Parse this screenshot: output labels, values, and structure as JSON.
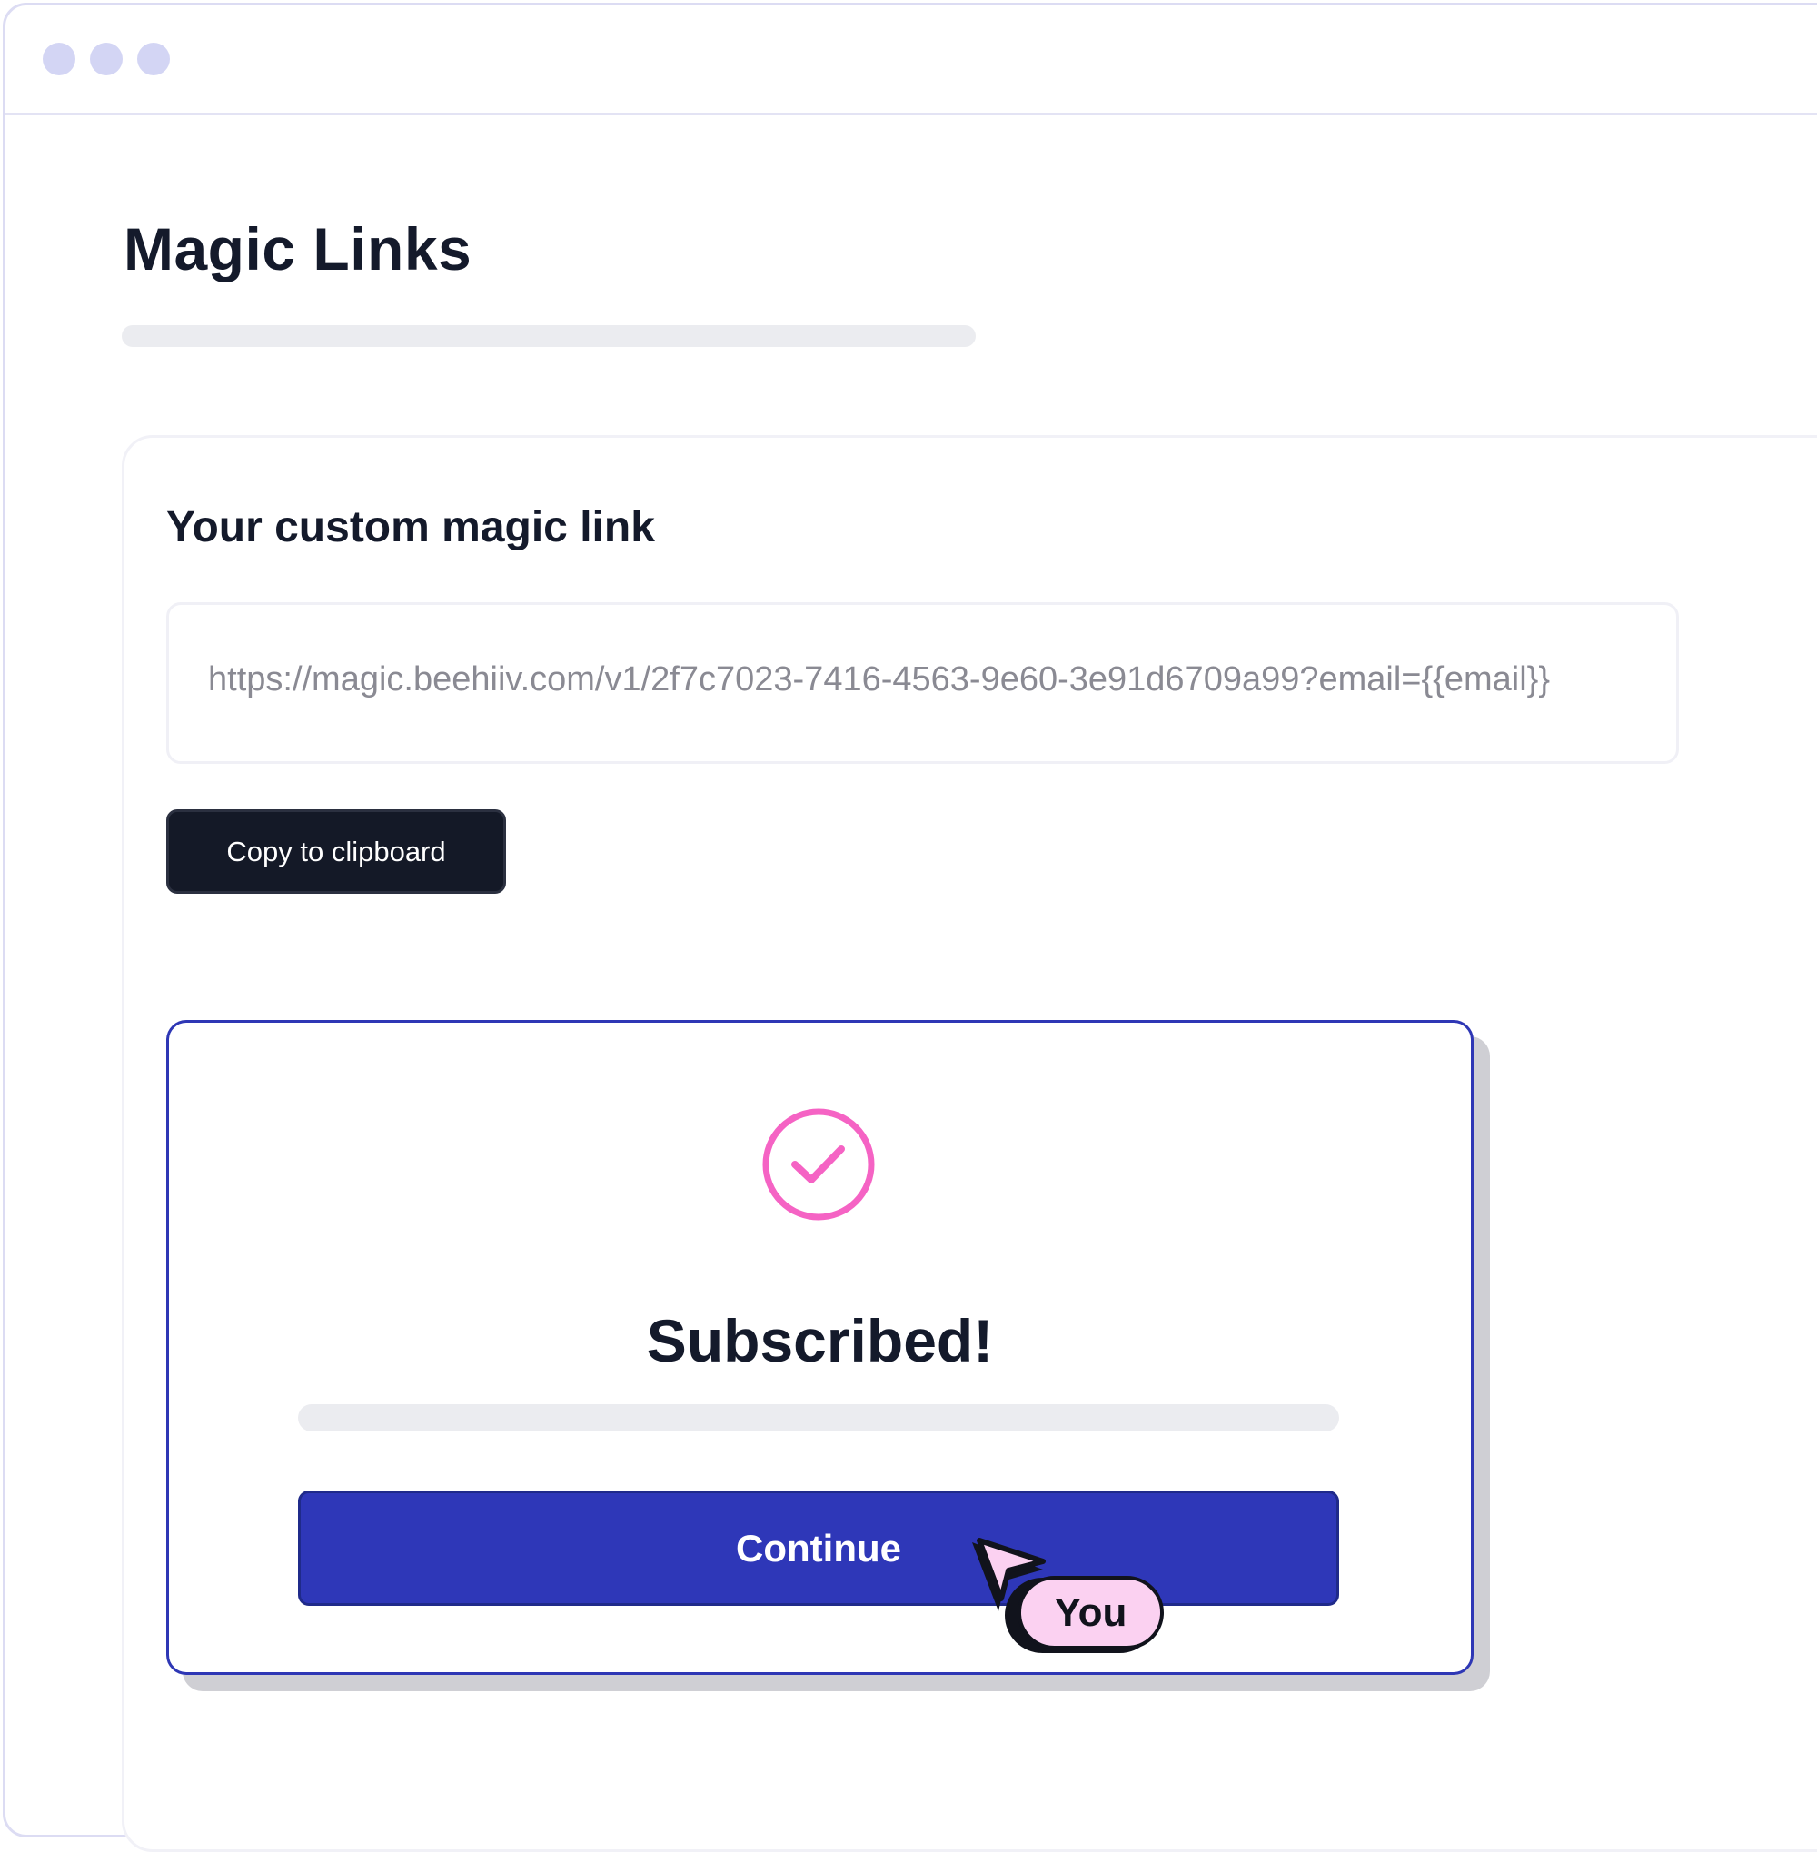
{
  "colors": {
    "window_dots": "#d3d5f4",
    "placeholder_bar": "#ebecf0",
    "dark_button": "#141927",
    "modal_border": "#2e37b5",
    "primary_button": "#2e37b8",
    "check_accent": "#f563c4",
    "you_badge": "#fbd1f1"
  },
  "page": {
    "title": "Magic Links"
  },
  "magic_link_card": {
    "heading": "Your custom magic link",
    "link_value": "https://magic.beehiiv.com/v1/2f7c7023-7416-4563-9e60-3e91d6709a99?email={{email}}",
    "copy_button_label": "Copy to clipboard"
  },
  "modal": {
    "icon": "check-circle-icon",
    "title": "Subscribed!",
    "continue_label": "Continue"
  },
  "cursor": {
    "icon": "pointer-arrow-icon",
    "label": "You"
  }
}
